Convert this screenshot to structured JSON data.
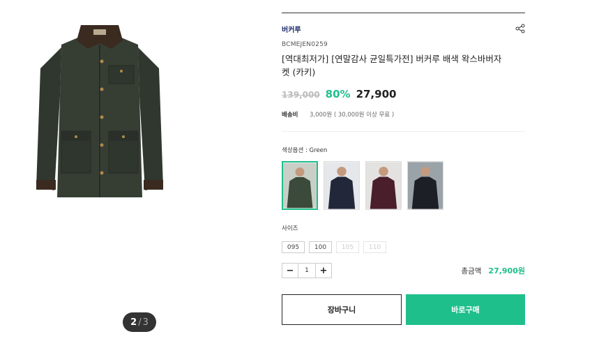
{
  "product": {
    "brand": "버커루",
    "code": "BCMEJEN0259",
    "title": "[역대최저가] [연말감사 균일특가전] 버커루 배색 왁스바버자켓 (카키)",
    "original_price": "139,000",
    "discount": "80%",
    "sale_price": "27,900"
  },
  "gallery": {
    "current": "2",
    "separator": "/",
    "total": "3"
  },
  "shipping": {
    "label": "배송비",
    "value": "3,000원 ( 30,000원 이상 무료 )"
  },
  "color_option": {
    "label": "색상옵션 : Green",
    "swatches": [
      {
        "name": "Green",
        "jacket_color": "#3b4a3a",
        "selected": true
      },
      {
        "name": "Navy",
        "jacket_color": "#22283a",
        "selected": false
      },
      {
        "name": "Burgundy",
        "jacket_color": "#4a1f2a",
        "selected": false
      },
      {
        "name": "Black",
        "jacket_color": "#1d1f26",
        "selected": false
      }
    ]
  },
  "size_option": {
    "label": "사이즈",
    "sizes": [
      {
        "label": "095",
        "available": true
      },
      {
        "label": "100",
        "available": true
      },
      {
        "label": "105",
        "available": false
      },
      {
        "label": "110",
        "available": false
      }
    ]
  },
  "quantity": {
    "minus": "−",
    "value": "1",
    "plus": "+"
  },
  "total": {
    "label": "총금액",
    "value": "27,900원"
  },
  "actions": {
    "cart": "장바구니",
    "buy": "바로구매"
  },
  "colors": {
    "accent": "#1fbf8c",
    "brand": "#1e2b6b",
    "jacket": "#343b32",
    "collar": "#3a2a1f"
  }
}
